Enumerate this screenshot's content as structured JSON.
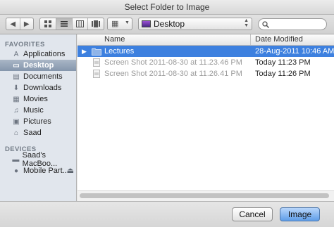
{
  "window": {
    "title": "Select Folder to Image"
  },
  "toolbar": {
    "back_glyph": "◀",
    "forward_glyph": "▶",
    "view_icons": [
      "icon-view-icon",
      "list-view-icon",
      "column-view-icon",
      "coverflow-view-icon"
    ],
    "arrange_glyph": "▦",
    "location": "Desktop",
    "search_value": ""
  },
  "sidebar": {
    "favorites_heading": "FAVORITES",
    "favorites": [
      {
        "label": "Applications",
        "icon": "applications-icon",
        "glyph": "A"
      },
      {
        "label": "Desktop",
        "icon": "desktop-icon",
        "glyph": "▭",
        "selected": true
      },
      {
        "label": "Documents",
        "icon": "documents-icon",
        "glyph": "▤"
      },
      {
        "label": "Downloads",
        "icon": "downloads-icon",
        "glyph": "⬇"
      },
      {
        "label": "Movies",
        "icon": "movies-icon",
        "glyph": "▦"
      },
      {
        "label": "Music",
        "icon": "music-icon",
        "glyph": "♫"
      },
      {
        "label": "Pictures",
        "icon": "pictures-icon",
        "glyph": "▣"
      },
      {
        "label": "Saad",
        "icon": "home-icon",
        "glyph": "⌂"
      }
    ],
    "devices_heading": "DEVICES",
    "devices": [
      {
        "label": "Saad's MacBoo...",
        "icon": "laptop-icon",
        "glyph": "▬"
      },
      {
        "label": "Mobile Part...",
        "icon": "disk-icon",
        "glyph": "●",
        "eject_glyph": "⏏"
      }
    ]
  },
  "file_list": {
    "columns": [
      "Name",
      "Date Modified"
    ],
    "rows": [
      {
        "name": "Lectures",
        "date": "28-Aug-2011 10:46 AM",
        "kind": "folder",
        "selected": true,
        "disclosure": "▶"
      },
      {
        "name": "Screen Shot 2011-08-30 at 11.23.46 PM",
        "date": "Today 11:23 PM",
        "kind": "image",
        "dimmed": true
      },
      {
        "name": "Screen Shot 2011-08-30 at 11.26.41 PM",
        "date": "Today 11:26 PM",
        "kind": "image",
        "dimmed": true
      }
    ]
  },
  "buttons": {
    "cancel": "Cancel",
    "confirm": "Image"
  },
  "colors": {
    "selection": "#3d80df",
    "sidebar_bg": "#e1e6ed",
    "default_button": "#5f9de8"
  }
}
